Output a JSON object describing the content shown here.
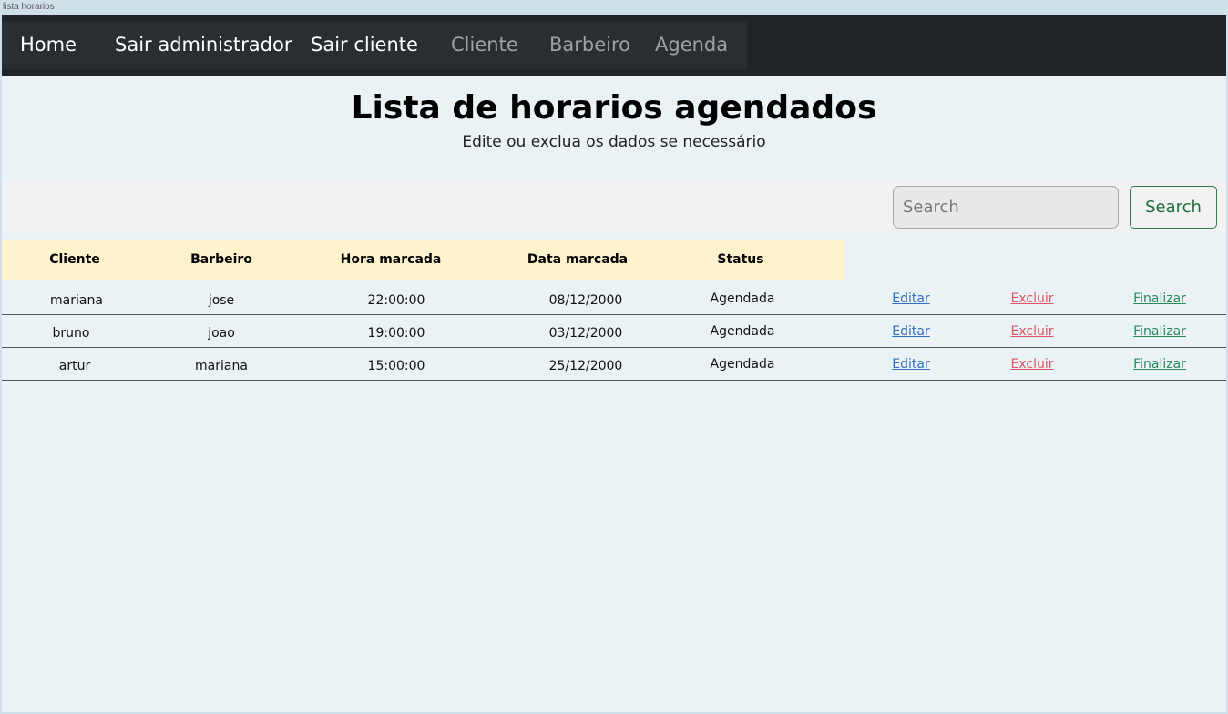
{
  "window": {
    "title": "lista horarios"
  },
  "nav": {
    "home": "Home",
    "sair_administrador": "Sair administrador",
    "sair_cliente": "Sair cliente",
    "cliente": "Cliente",
    "barbeiro": "Barbeiro",
    "agenda": "Agenda"
  },
  "header": {
    "title": "Lista de horarios agendados",
    "subtitle": "Edite ou exclua os dados se necessário"
  },
  "search": {
    "placeholder": "Search",
    "button_label": "Search"
  },
  "table": {
    "columns": [
      "Cliente",
      "Barbeiro",
      "Hora marcada",
      "Data marcada",
      "Status"
    ],
    "actions": {
      "edit": "Editar",
      "delete": "Excluir",
      "finish": "Finalizar"
    },
    "rows": [
      {
        "cliente": "mariana",
        "barbeiro": "jose",
        "hora": "22:00:00",
        "data": "08/12/2000",
        "status": "Agendada"
      },
      {
        "cliente": "bruno",
        "barbeiro": "joao",
        "hora": "19:00:00",
        "data": "03/12/2000",
        "status": "Agendada"
      },
      {
        "cliente": "artur",
        "barbeiro": "mariana",
        "hora": "15:00:00",
        "data": "25/12/2000",
        "status": "Agendada"
      }
    ]
  },
  "colors": {
    "navbar": "#212529",
    "table_header": "#fff3cd",
    "edit_link": "#2f6fc4",
    "delete_link": "#e05763",
    "finish_link": "#2b8a5a",
    "search_button": "#1f6b3f"
  }
}
